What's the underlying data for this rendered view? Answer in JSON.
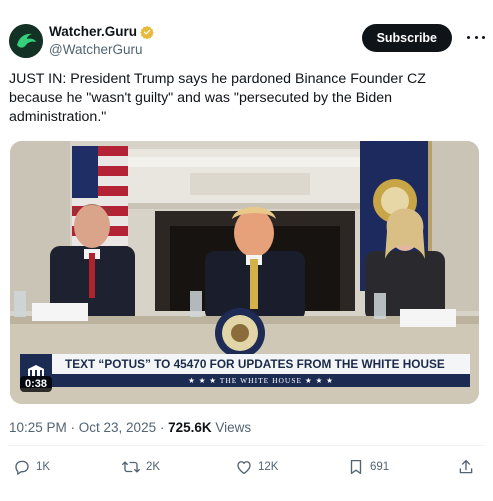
{
  "author": {
    "display_name": "Watcher.Guru",
    "handle": "@WatcherGuru",
    "verified_badge_icon": "gold-verified-badge-icon",
    "avatar_icon": "watcher-guru-logo-icon"
  },
  "header": {
    "subscribe_label": "Subscribe",
    "more_icon": "more-horizontal-icon"
  },
  "tweet": {
    "text": "JUST IN: President Trump says he pardoned Binance Founder CZ because he \"wasn't guilty\" and was \"persecuted by the Biden administration.\""
  },
  "media": {
    "banner_text": "TEXT “POTUS” TO 45470 FOR UPDATES FROM THE WHITE HOUSE",
    "banner_subtext": "★ ★ ★  THE WHITE HOUSE  ★ ★ ★",
    "duration": "0:38"
  },
  "meta": {
    "timestamp": "10:25 PM · Oct 23, 2025 · ",
    "views_count": "725.6K",
    "views_label": " Views"
  },
  "actions": {
    "reply": {
      "icon": "reply-icon",
      "count": "1K"
    },
    "repost": {
      "icon": "repost-icon",
      "count": "2K"
    },
    "like": {
      "icon": "heart-icon",
      "count": "12K"
    },
    "bookmark": {
      "icon": "bookmark-icon",
      "count": "691"
    },
    "share": {
      "icon": "share-icon"
    }
  },
  "colors": {
    "text": "#0f1419",
    "secondary": "#536471",
    "badge_gold": "#e8b93a",
    "banner_navy": "#1b2b52",
    "subscribe_bg": "#0f1419"
  }
}
